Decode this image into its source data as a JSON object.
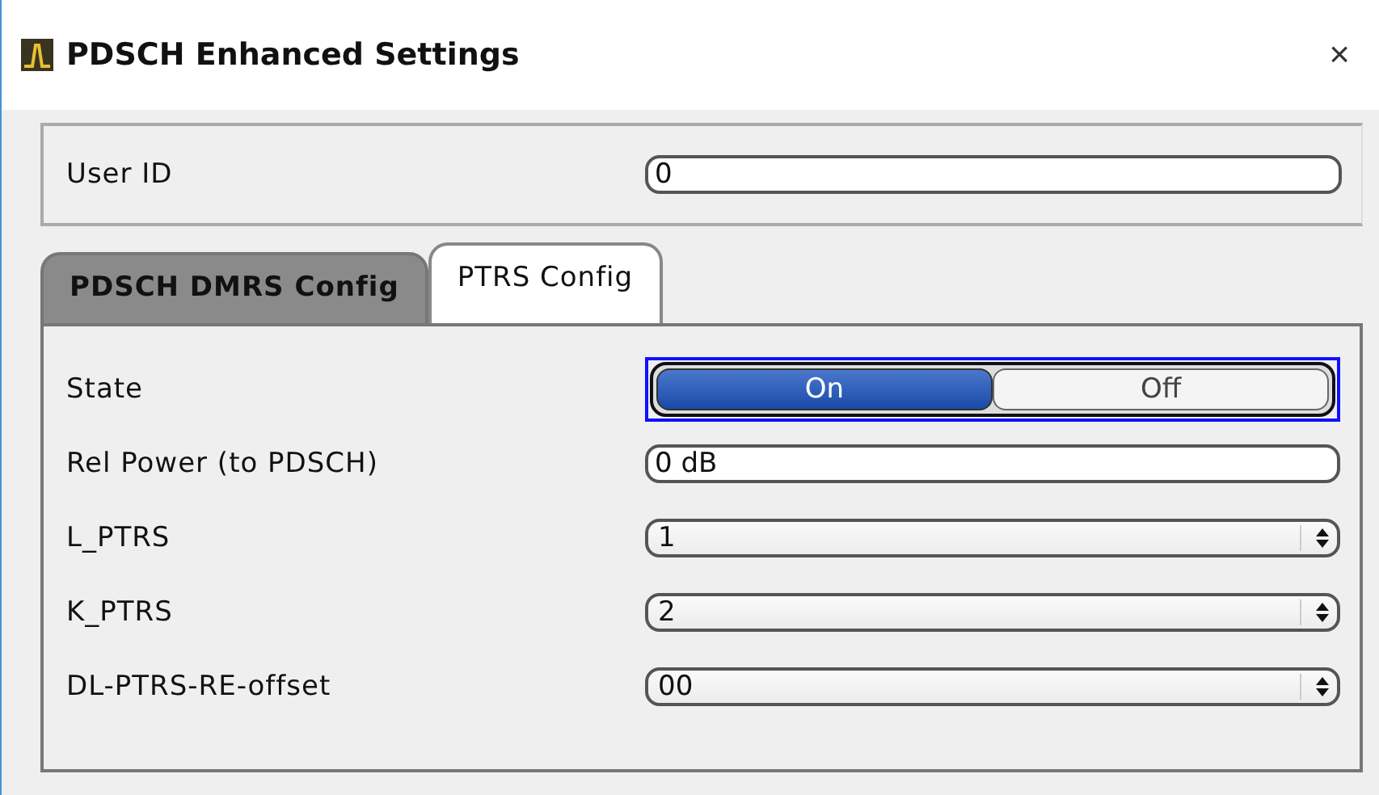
{
  "window": {
    "title": "PDSCH Enhanced Settings",
    "close": "×"
  },
  "user_id": {
    "label": "User ID",
    "value": "0"
  },
  "tabs": [
    {
      "label": "PDSCH DMRS Config",
      "selected": false
    },
    {
      "label": "PTRS Config",
      "selected": true
    }
  ],
  "rows": [
    {
      "kind": "toggle",
      "label": "State",
      "options": [
        {
          "label": "On",
          "selected": true
        },
        {
          "label": "Off",
          "selected": false
        }
      ]
    },
    {
      "kind": "text",
      "label": "Rel Power (to PDSCH)",
      "value": "0 dB"
    },
    {
      "kind": "select",
      "label": "L_PTRS",
      "value": "1"
    },
    {
      "kind": "select",
      "label": "K_PTRS",
      "value": "2"
    },
    {
      "kind": "select",
      "label": "DL-PTRS-RE-offset",
      "value": "00"
    }
  ]
}
